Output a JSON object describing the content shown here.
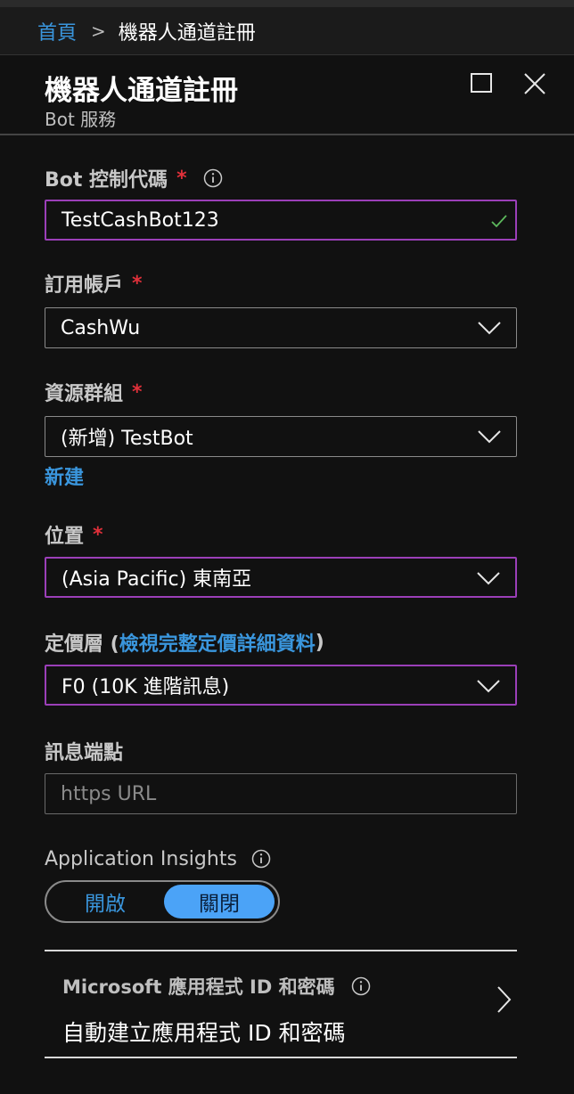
{
  "breadcrumb": {
    "home": "首頁",
    "separator": ">",
    "current": "機器人通道註冊"
  },
  "header": {
    "title": "機器人通道註冊",
    "subtitle": "Bot 服務"
  },
  "fields": {
    "bot_handle": {
      "label": "Bot 控制代碼",
      "required_mark": "*",
      "value": "TestCashBot123"
    },
    "subscription": {
      "label": "訂用帳戶",
      "required_mark": "*",
      "value": "CashWu"
    },
    "resource_group": {
      "label": "資源群組",
      "required_mark": "*",
      "value": "(新增) TestBot",
      "new_link": "新建"
    },
    "location": {
      "label": "位置",
      "required_mark": "*",
      "value": "(Asia Pacific) 東南亞"
    },
    "pricing_tier": {
      "label_prefix": "定價層 (",
      "label_link": "檢視完整定價詳細資料",
      "label_suffix": ")",
      "value": "F0 (10K 進階訊息)"
    },
    "messaging_endpoint": {
      "label": "訊息端點",
      "placeholder": "https URL"
    },
    "app_insights": {
      "label": "Application Insights",
      "on_label": "開啟",
      "off_label": "關閉",
      "selected": "關閉"
    }
  },
  "app_id_section": {
    "label": "Microsoft 應用程式 ID 和密碼",
    "value": "自動建立應用程式 ID 和密碼"
  },
  "colors": {
    "accent_blue": "#3a96dd",
    "required_red": "#e0303a",
    "focus_purple": "#9b3fb8",
    "valid_green": "#5cb85c",
    "toggle_selected": "#4ba3f7"
  }
}
